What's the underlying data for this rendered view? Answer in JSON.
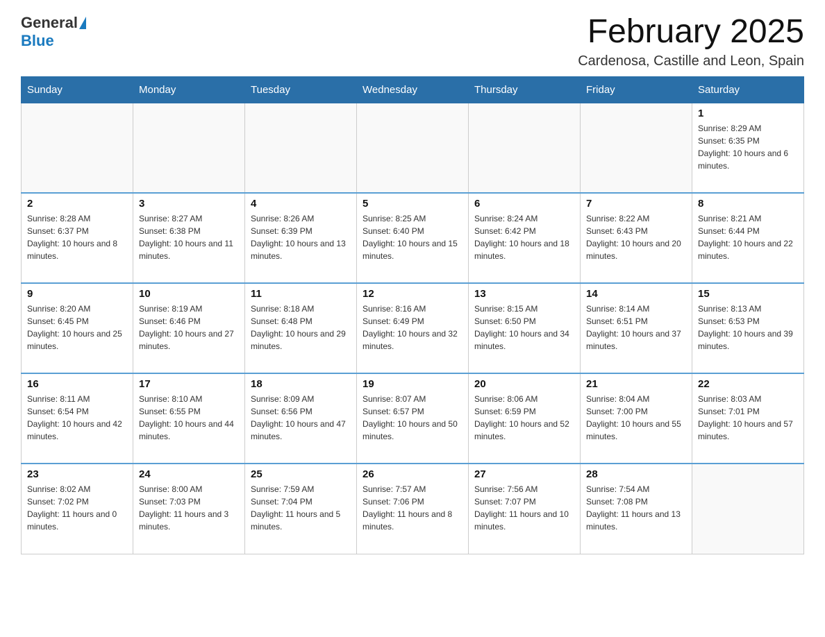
{
  "header": {
    "logo_general": "General",
    "logo_blue": "Blue",
    "month_title": "February 2025",
    "location": "Cardenosa, Castille and Leon, Spain"
  },
  "days_of_week": [
    "Sunday",
    "Monday",
    "Tuesday",
    "Wednesday",
    "Thursday",
    "Friday",
    "Saturday"
  ],
  "weeks": [
    [
      {
        "day": "",
        "info": ""
      },
      {
        "day": "",
        "info": ""
      },
      {
        "day": "",
        "info": ""
      },
      {
        "day": "",
        "info": ""
      },
      {
        "day": "",
        "info": ""
      },
      {
        "day": "",
        "info": ""
      },
      {
        "day": "1",
        "info": "Sunrise: 8:29 AM\nSunset: 6:35 PM\nDaylight: 10 hours and 6 minutes."
      }
    ],
    [
      {
        "day": "2",
        "info": "Sunrise: 8:28 AM\nSunset: 6:37 PM\nDaylight: 10 hours and 8 minutes."
      },
      {
        "day": "3",
        "info": "Sunrise: 8:27 AM\nSunset: 6:38 PM\nDaylight: 10 hours and 11 minutes."
      },
      {
        "day": "4",
        "info": "Sunrise: 8:26 AM\nSunset: 6:39 PM\nDaylight: 10 hours and 13 minutes."
      },
      {
        "day": "5",
        "info": "Sunrise: 8:25 AM\nSunset: 6:40 PM\nDaylight: 10 hours and 15 minutes."
      },
      {
        "day": "6",
        "info": "Sunrise: 8:24 AM\nSunset: 6:42 PM\nDaylight: 10 hours and 18 minutes."
      },
      {
        "day": "7",
        "info": "Sunrise: 8:22 AM\nSunset: 6:43 PM\nDaylight: 10 hours and 20 minutes."
      },
      {
        "day": "8",
        "info": "Sunrise: 8:21 AM\nSunset: 6:44 PM\nDaylight: 10 hours and 22 minutes."
      }
    ],
    [
      {
        "day": "9",
        "info": "Sunrise: 8:20 AM\nSunset: 6:45 PM\nDaylight: 10 hours and 25 minutes."
      },
      {
        "day": "10",
        "info": "Sunrise: 8:19 AM\nSunset: 6:46 PM\nDaylight: 10 hours and 27 minutes."
      },
      {
        "day": "11",
        "info": "Sunrise: 8:18 AM\nSunset: 6:48 PM\nDaylight: 10 hours and 29 minutes."
      },
      {
        "day": "12",
        "info": "Sunrise: 8:16 AM\nSunset: 6:49 PM\nDaylight: 10 hours and 32 minutes."
      },
      {
        "day": "13",
        "info": "Sunrise: 8:15 AM\nSunset: 6:50 PM\nDaylight: 10 hours and 34 minutes."
      },
      {
        "day": "14",
        "info": "Sunrise: 8:14 AM\nSunset: 6:51 PM\nDaylight: 10 hours and 37 minutes."
      },
      {
        "day": "15",
        "info": "Sunrise: 8:13 AM\nSunset: 6:53 PM\nDaylight: 10 hours and 39 minutes."
      }
    ],
    [
      {
        "day": "16",
        "info": "Sunrise: 8:11 AM\nSunset: 6:54 PM\nDaylight: 10 hours and 42 minutes."
      },
      {
        "day": "17",
        "info": "Sunrise: 8:10 AM\nSunset: 6:55 PM\nDaylight: 10 hours and 44 minutes."
      },
      {
        "day": "18",
        "info": "Sunrise: 8:09 AM\nSunset: 6:56 PM\nDaylight: 10 hours and 47 minutes."
      },
      {
        "day": "19",
        "info": "Sunrise: 8:07 AM\nSunset: 6:57 PM\nDaylight: 10 hours and 50 minutes."
      },
      {
        "day": "20",
        "info": "Sunrise: 8:06 AM\nSunset: 6:59 PM\nDaylight: 10 hours and 52 minutes."
      },
      {
        "day": "21",
        "info": "Sunrise: 8:04 AM\nSunset: 7:00 PM\nDaylight: 10 hours and 55 minutes."
      },
      {
        "day": "22",
        "info": "Sunrise: 8:03 AM\nSunset: 7:01 PM\nDaylight: 10 hours and 57 minutes."
      }
    ],
    [
      {
        "day": "23",
        "info": "Sunrise: 8:02 AM\nSunset: 7:02 PM\nDaylight: 11 hours and 0 minutes."
      },
      {
        "day": "24",
        "info": "Sunrise: 8:00 AM\nSunset: 7:03 PM\nDaylight: 11 hours and 3 minutes."
      },
      {
        "day": "25",
        "info": "Sunrise: 7:59 AM\nSunset: 7:04 PM\nDaylight: 11 hours and 5 minutes."
      },
      {
        "day": "26",
        "info": "Sunrise: 7:57 AM\nSunset: 7:06 PM\nDaylight: 11 hours and 8 minutes."
      },
      {
        "day": "27",
        "info": "Sunrise: 7:56 AM\nSunset: 7:07 PM\nDaylight: 11 hours and 10 minutes."
      },
      {
        "day": "28",
        "info": "Sunrise: 7:54 AM\nSunset: 7:08 PM\nDaylight: 11 hours and 13 minutes."
      },
      {
        "day": "",
        "info": ""
      }
    ]
  ]
}
